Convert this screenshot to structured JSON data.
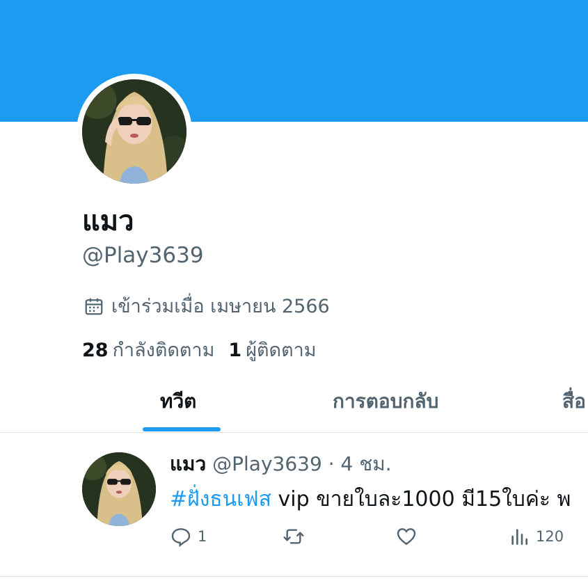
{
  "profile": {
    "display_name": "แมว",
    "handle": "@Play3639",
    "joined": "เข้าร่วมเมื่อ เมษายน 2566",
    "following_count": "28",
    "following_label": "กำลังติดตาม",
    "followers_count": "1",
    "followers_label": "ผู้ติดตาม"
  },
  "tabs": [
    {
      "label": "ทวีต",
      "active": true
    },
    {
      "label": "การตอบกลับ",
      "active": false
    },
    {
      "label": "สื่อ",
      "active": false
    }
  ],
  "tweet": {
    "name": "แมว",
    "handle": "@Play3639",
    "separator": "·",
    "time": "4 ชม.",
    "hashtag": "#ฝั่งธนเฟส",
    "text": " vip ขายใบละ1000 มี15ใบค่ะ พ",
    "replies": "1",
    "retweets": "",
    "likes": "",
    "views": "120"
  },
  "colors": {
    "banner": "#1d9bf0",
    "accent": "#1d9bf0",
    "secondary_text": "#536471"
  },
  "icons": [
    "calendar-icon",
    "reply-icon",
    "retweet-icon",
    "like-icon",
    "views-icon"
  ]
}
